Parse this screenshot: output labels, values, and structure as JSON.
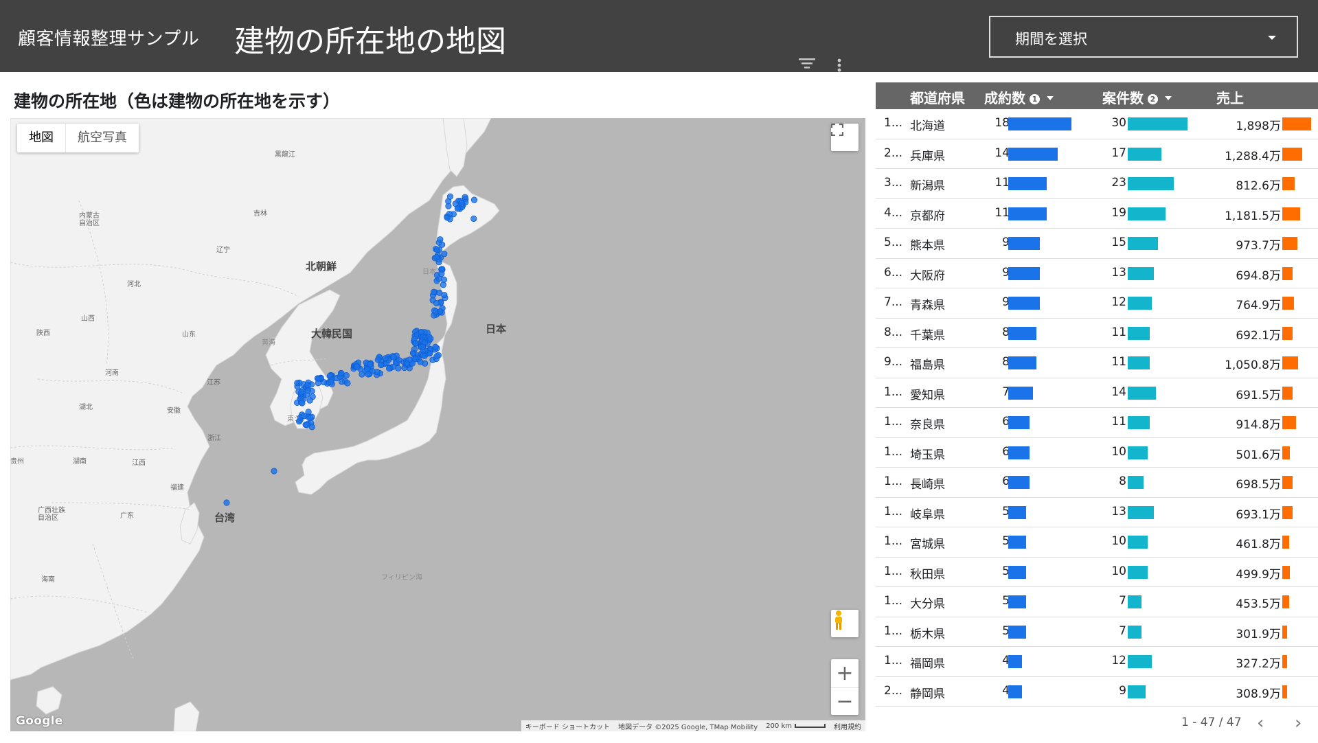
{
  "header": {
    "app_title": "顧客情報整理サンプル",
    "report_title": "建物の所在地の地図",
    "date_picker_label": "期間を選択"
  },
  "map_section": {
    "title": "建物の所在地（色は建物の所在地を示す）",
    "map_type_buttons": [
      "地図",
      "航空写真"
    ],
    "labels": {
      "heilongjiang": "黒龍江",
      "inner_mongolia": "内蒙古\n自治区",
      "jilin": "吉林",
      "liaoning": "辽宁",
      "north_korea": "北朝鮮",
      "sea_of_japan": "日本海",
      "hebei": "河北",
      "shanxi": "山西",
      "shaanxi": "陕西",
      "shandong": "山东",
      "yellow_sea": "黄海",
      "south_korea": "大韓民国",
      "japan": "日本",
      "henan": "河南",
      "jiangsu": "江苏",
      "hubei": "湖北",
      "anhui": "安徽",
      "east_china_sea": "東シナ海",
      "zhejiang": "浙江",
      "guizhou": "贵州",
      "hunan": "湖南",
      "jiangxi": "江西",
      "fujian": "福建",
      "guangxi": "广西壮族\n自治区",
      "guangdong": "广东",
      "taiwan": "台湾",
      "hainan": "海南",
      "philippine_sea": "フィリピン海"
    },
    "google_logo": "Google",
    "attribution": {
      "shortcuts": "キーボード ショートカット",
      "data": "地図データ ©2025 Google, TMap Mobility",
      "scale": "200 km",
      "terms": "利用規約"
    },
    "marker_color": "#1a73e8"
  },
  "table": {
    "columns": [
      "都道府県",
      "成約数",
      "案件数",
      "売上"
    ],
    "colors": {
      "contracts": "#1a73e8",
      "cases": "#12b5cb",
      "sales": "#ff6d01"
    },
    "rows": [
      {
        "idx": "1...",
        "pref": "北海道",
        "contracts": 18,
        "cases": 30,
        "sales": "1,898万",
        "sales_value": 1898
      },
      {
        "idx": "2...",
        "pref": "兵庫県",
        "contracts": 14,
        "cases": 17,
        "sales": "1,288.4万",
        "sales_value": 1288.4
      },
      {
        "idx": "3...",
        "pref": "新潟県",
        "contracts": 11,
        "cases": 23,
        "sales": "812.6万",
        "sales_value": 812.6
      },
      {
        "idx": "4...",
        "pref": "京都府",
        "contracts": 11,
        "cases": 19,
        "sales": "1,181.5万",
        "sales_value": 1181.5
      },
      {
        "idx": "5...",
        "pref": "熊本県",
        "contracts": 9,
        "cases": 15,
        "sales": "973.7万",
        "sales_value": 973.7
      },
      {
        "idx": "6...",
        "pref": "大阪府",
        "contracts": 9,
        "cases": 13,
        "sales": "694.8万",
        "sales_value": 694.8
      },
      {
        "idx": "7...",
        "pref": "青森県",
        "contracts": 9,
        "cases": 12,
        "sales": "764.9万",
        "sales_value": 764.9
      },
      {
        "idx": "8...",
        "pref": "千葉県",
        "contracts": 8,
        "cases": 11,
        "sales": "692.1万",
        "sales_value": 692.1
      },
      {
        "idx": "9...",
        "pref": "福島県",
        "contracts": 8,
        "cases": 11,
        "sales": "1,050.8万",
        "sales_value": 1050.8
      },
      {
        "idx": "1...",
        "pref": "愛知県",
        "contracts": 7,
        "cases": 14,
        "sales": "691.5万",
        "sales_value": 691.5
      },
      {
        "idx": "1...",
        "pref": "奈良県",
        "contracts": 6,
        "cases": 11,
        "sales": "914.8万",
        "sales_value": 914.8
      },
      {
        "idx": "1...",
        "pref": "埼玉県",
        "contracts": 6,
        "cases": 10,
        "sales": "501.6万",
        "sales_value": 501.6
      },
      {
        "idx": "1...",
        "pref": "長崎県",
        "contracts": 6,
        "cases": 8,
        "sales": "698.5万",
        "sales_value": 698.5
      },
      {
        "idx": "1...",
        "pref": "岐阜県",
        "contracts": 5,
        "cases": 13,
        "sales": "693.1万",
        "sales_value": 693.1
      },
      {
        "idx": "1...",
        "pref": "宮城県",
        "contracts": 5,
        "cases": 10,
        "sales": "461.8万",
        "sales_value": 461.8
      },
      {
        "idx": "1...",
        "pref": "秋田県",
        "contracts": 5,
        "cases": 10,
        "sales": "499.9万",
        "sales_value": 499.9
      },
      {
        "idx": "1...",
        "pref": "大分県",
        "contracts": 5,
        "cases": 7,
        "sales": "453.5万",
        "sales_value": 453.5
      },
      {
        "idx": "1...",
        "pref": "栃木県",
        "contracts": 5,
        "cases": 7,
        "sales": "301.9万",
        "sales_value": 301.9
      },
      {
        "idx": "1...",
        "pref": "福岡県",
        "contracts": 4,
        "cases": 12,
        "sales": "327.2万",
        "sales_value": 327.2
      },
      {
        "idx": "2...",
        "pref": "静岡県",
        "contracts": 4,
        "cases": 9,
        "sales": "308.9万",
        "sales_value": 308.9
      }
    ],
    "max": {
      "contracts": 18,
      "cases": 30,
      "sales": 1898
    },
    "pagination": "1 - 47 / 47"
  }
}
